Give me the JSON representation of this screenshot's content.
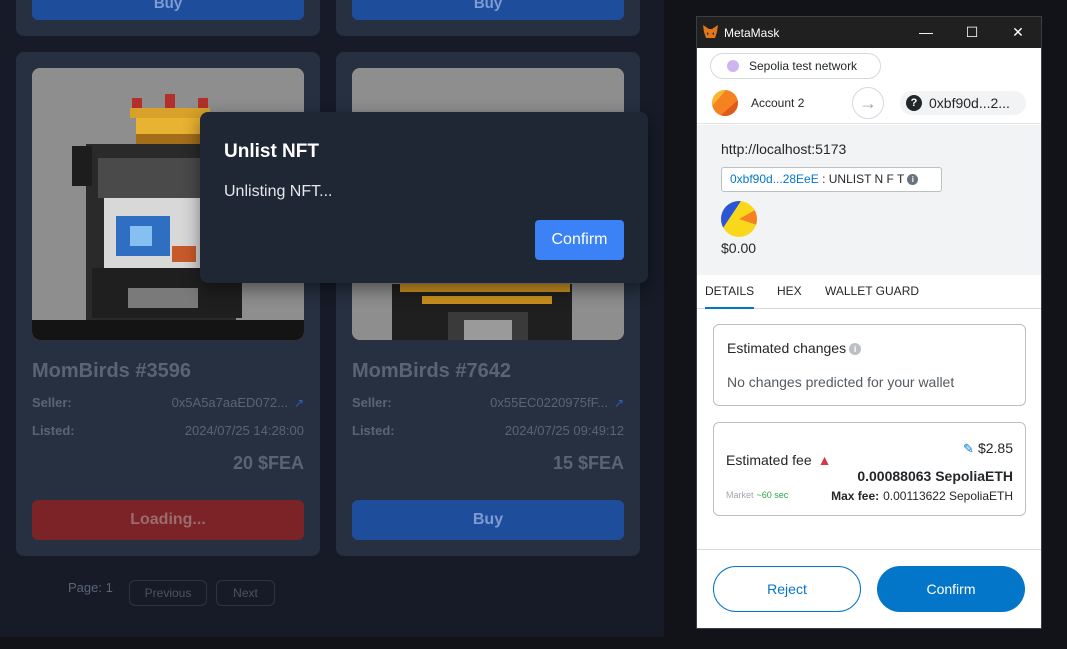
{
  "colors": {
    "page_background": "#111318",
    "app_background": "#161b27",
    "card_background": "#263040",
    "buy_button": "#1e4d9c",
    "loading_button": "#7b2326",
    "modal_confirm": "#3b82f6",
    "metamask_primary": "#0376c9",
    "warning": "#d73847"
  },
  "top_cards": [
    {
      "button_label": "Buy"
    },
    {
      "button_label": "Buy"
    }
  ],
  "cards": [
    {
      "title": "MomBirds #3596",
      "seller_label": "Seller:",
      "seller_value": "0x5A5a7aaED072...",
      "listed_label": "Listed:",
      "listed_value": "2024/07/25 14:28:00",
      "price": "20 $FEA",
      "button_label": "Loading...",
      "button_state": "loading"
    },
    {
      "title": "MomBirds #7642",
      "seller_label": "Seller:",
      "seller_value": "0x55EC0220975fF...",
      "listed_label": "Listed:",
      "listed_value": "2024/07/25 09:49:12",
      "price": "15 $FEA",
      "button_label": "Buy",
      "button_state": "buy"
    }
  ],
  "pagination": {
    "page_label": "Page: 1",
    "previous_label": "Previous",
    "next_label": "Next"
  },
  "modal": {
    "title": "Unlist NFT",
    "message": "Unlisting NFT...",
    "confirm_label": "Confirm"
  },
  "metamask": {
    "window_title": "MetaMask",
    "network": "Sepolia test network",
    "account_name": "Account 2",
    "recipient": "0xbf90d...2...",
    "origin": "http://localhost:5173",
    "method_address": "0xbf90d...28EeE",
    "method_separator": " : ",
    "method_name": "UNLIST N F T",
    "amount": "$0.00",
    "tabs": [
      "DETAILS",
      "HEX",
      "WALLET GUARD"
    ],
    "active_tab": "DETAILS",
    "estimated_changes_title": "Estimated changes",
    "estimated_changes_text": "No changes predicted for your wallet",
    "estimated_fee_label": "Estimated fee",
    "fee_fiat": "$2.85",
    "fee_eth": "0.00088063 SepoliaETH",
    "market_label": "Market",
    "market_time": "~60 sec",
    "max_fee_label": "Max fee:",
    "max_fee_value": "0.00113622 SepoliaETH",
    "reject_label": "Reject",
    "confirm_label": "Confirm",
    "icons": [
      "metamask-fox-icon",
      "minimize-icon",
      "maximize-icon",
      "close-icon",
      "arrow-right-icon",
      "question-icon",
      "info-icon",
      "warning-icon",
      "edit-icon",
      "external-link-icon"
    ]
  }
}
